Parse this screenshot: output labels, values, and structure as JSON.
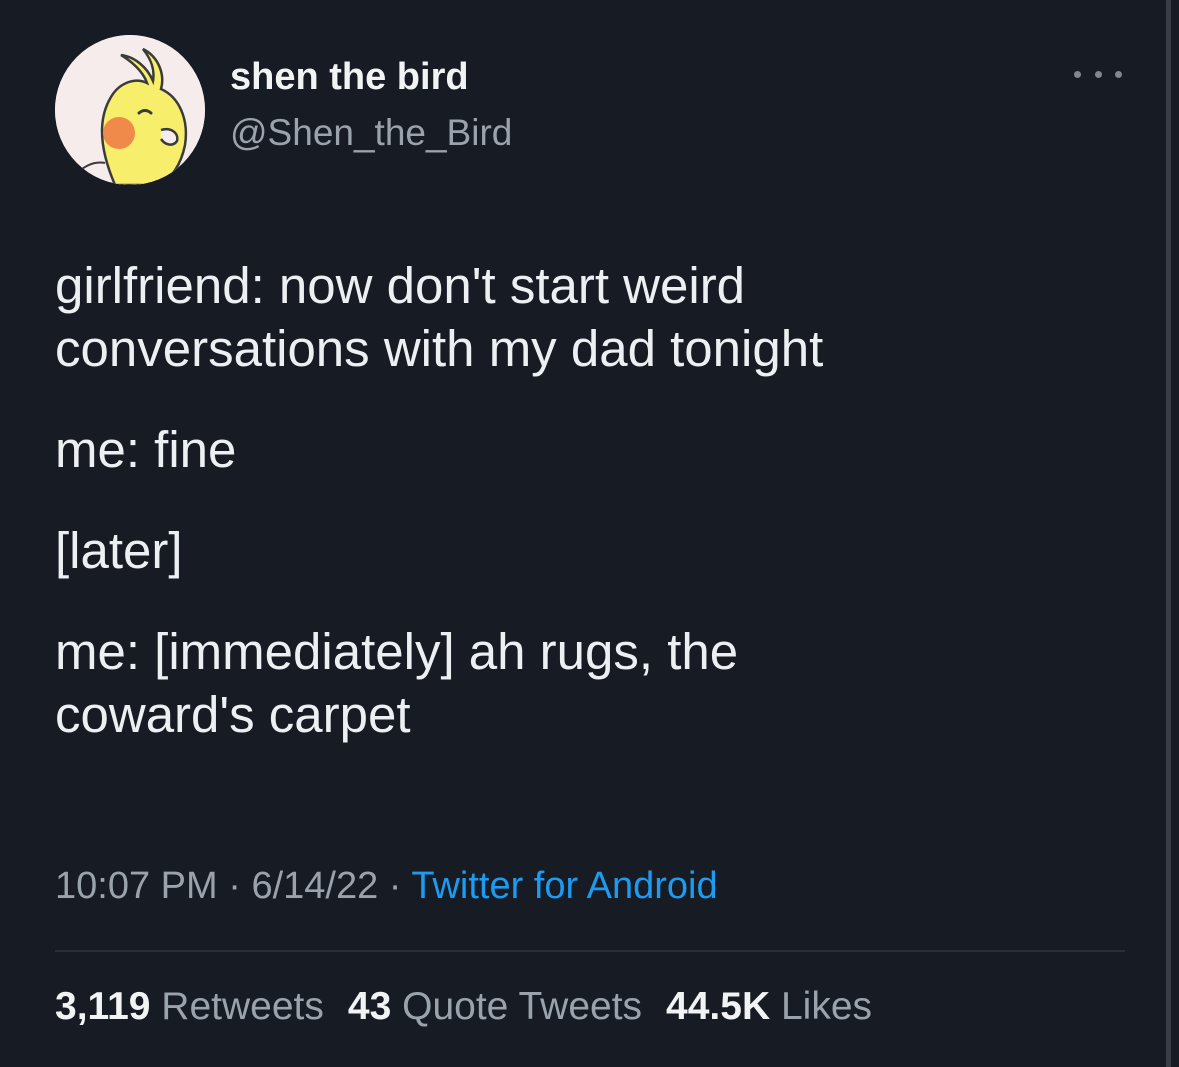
{
  "author": {
    "display_name": "shen the bird",
    "handle": "@Shen_the_Bird",
    "avatar_icon": "cockatiel-avatar-icon"
  },
  "menu_icon": "more-options-icon",
  "tweet": {
    "paragraphs": [
      [
        "girlfriend: now don't start weird",
        "conversations with my dad tonight"
      ],
      [
        "me: fine"
      ],
      [
        "[later]"
      ],
      [
        "me: [immediately] ah rugs, the",
        "coward's carpet"
      ]
    ]
  },
  "meta": {
    "time": "10:07 PM",
    "separator": " · ",
    "date": "6/14/22",
    "source": "Twitter for Android"
  },
  "stats": {
    "retweets_count": "3,119",
    "retweets_label": "Retweets",
    "quotes_count": "43",
    "quotes_label": "Quote Tweets",
    "likes_count": "44.5K",
    "likes_label": "Likes"
  },
  "colors": {
    "background": "#161b24",
    "text": "#edf0f2",
    "secondary_text": "#9aa2ab",
    "link": "#1d9bf0"
  }
}
